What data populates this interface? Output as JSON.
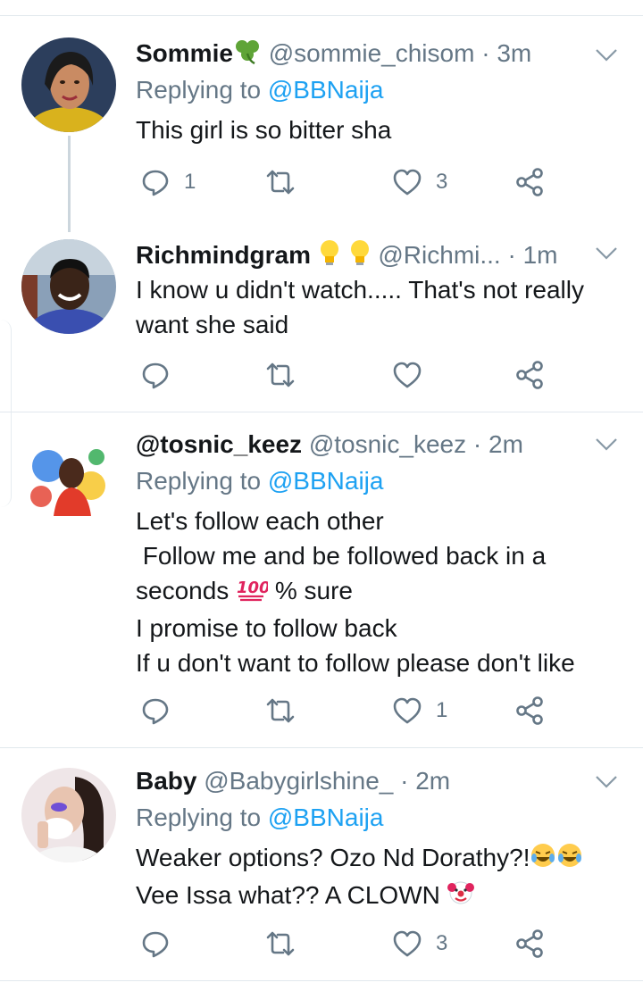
{
  "tweets": [
    {
      "name": "Sommie",
      "handle": "@sommie_chisom",
      "time": "3m",
      "replying_label": "Replying to",
      "replying_to": "@BBNaija",
      "lines": [
        "This girl is so bitter sha"
      ],
      "reply_count": "1",
      "retweet_count": "",
      "like_count": "3"
    },
    {
      "name": "Richmindgram",
      "handle": "@Richmi...",
      "time": "1m",
      "lines": [
        "I know u didn't watch..... That's not really",
        "want she said"
      ],
      "reply_count": "",
      "retweet_count": "",
      "like_count": ""
    },
    {
      "name": "@tosnic_keez",
      "handle": "@tosnic_keez",
      "time": "2m",
      "replying_label": "Replying to",
      "replying_to": "@BBNaija",
      "lines": [
        "Let's follow each other",
        " Follow me and be followed back in a",
        "seconds",
        "% sure",
        "I promise to follow back",
        "If u don't want to follow please don't like"
      ],
      "reply_count": "",
      "retweet_count": "",
      "like_count": "1"
    },
    {
      "name": "Baby",
      "handle": "@Babygirlshine_",
      "time": "2m",
      "replying_label": "Replying to",
      "replying_to": "@BBNaija",
      "lines": [
        "Weaker options? Ozo Nd Dorathy?!",
        "Vee Issa what?? A CLOWN"
      ],
      "reply_count": "",
      "retweet_count": "",
      "like_count": "3"
    }
  ],
  "separator": " · ",
  "icons": [
    "reply-icon",
    "retweet-icon",
    "like-icon",
    "share-icon",
    "chevron-down-icon",
    "shamrock-emoji",
    "lightbulb-emoji",
    "hundred-points-emoji",
    "laughing-tears-emoji",
    "clown-emoji"
  ],
  "colors": {
    "link": "#1da1f2",
    "muted": "#657786",
    "text": "#14171a",
    "border": "#e1e8ed"
  }
}
